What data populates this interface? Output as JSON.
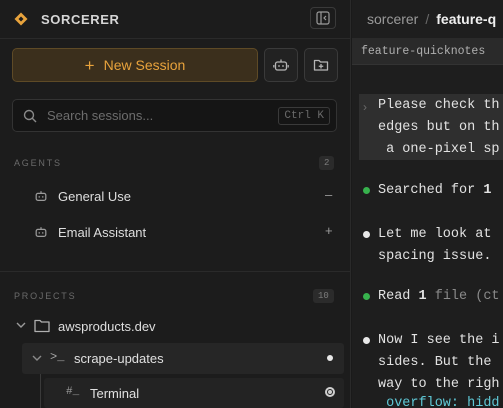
{
  "app": {
    "name": "SORCERER"
  },
  "sidebar": {
    "new_session_label": "New Session",
    "search": {
      "placeholder": "Search sessions...",
      "shortcut": "Ctrl K"
    },
    "agents": {
      "label": "AGENTS",
      "count": "2",
      "items": [
        {
          "label": "General Use",
          "action": "–"
        },
        {
          "label": "Email Assistant",
          "action": "+"
        }
      ]
    },
    "projects": {
      "label": "PROJECTS",
      "count": "10",
      "items": [
        {
          "label": "awsproducts.dev"
        }
      ],
      "session": {
        "prompt": ">_",
        "label": "scrape-updates"
      },
      "terminal": {
        "icon_text": "#_",
        "label": "Terminal"
      }
    }
  },
  "main": {
    "breadcrumb": {
      "root": "sorcerer",
      "sep": "/",
      "current": "feature-q"
    },
    "tab_label": "feature-quicknotes",
    "user_message": {
      "caret": "›",
      "lines": [
        "Please check th",
        "edges but on th",
        " a one-pixel sp"
      ]
    },
    "log": {
      "searched": {
        "prefix": "Searched for ",
        "count": "1"
      },
      "msg1": [
        "Let me look at ",
        "spacing issue."
      ],
      "read": {
        "prefix": "Read ",
        "count": "1",
        "suffix": " file (ct"
      },
      "msg2": [
        "Now I see the i",
        "sides. But the ",
        "way to the righ"
      ],
      "code": " overflow: hidd"
    }
  },
  "colors": {
    "accent": "#e8a33c",
    "success": "#37b24d",
    "code": "#5fc8d6"
  }
}
